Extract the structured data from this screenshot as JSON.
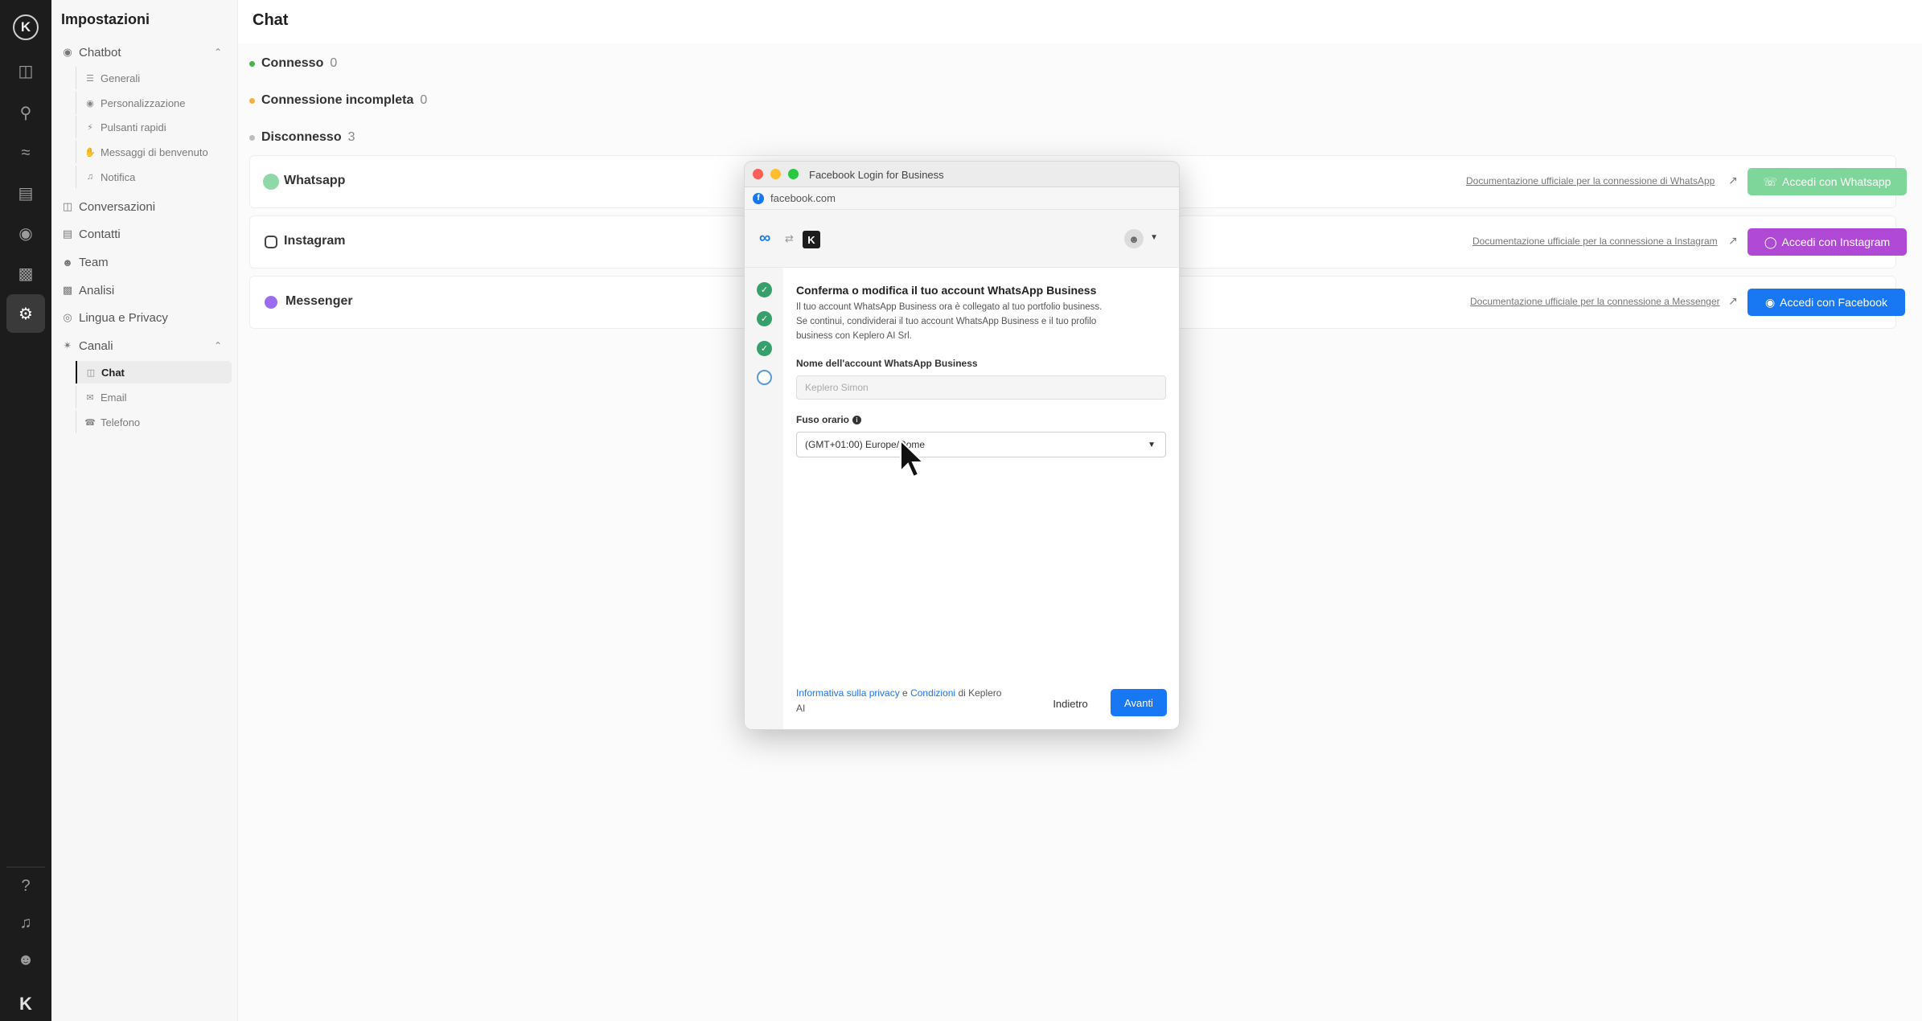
{
  "rail": {
    "items": [
      "logo",
      "chat-bubbles-icon",
      "location-pin-icon",
      "routing-icon",
      "contacts-book-icon",
      "bot-icon",
      "bar-chart-icon",
      "gear-icon"
    ],
    "bottom": [
      "help-icon",
      "bell-icon",
      "user-icon"
    ]
  },
  "sidebar": {
    "title": "Impostazioni",
    "chatbot": "Chatbot",
    "chatbot_items": [
      "Generali",
      "Personalizzazione",
      "Pulsanti rapidi",
      "Messaggi di benvenuto",
      "Notifica"
    ],
    "conversazioni": "Conversazioni",
    "contatti": "Contatti",
    "team": "Team",
    "analisi": "Analisi",
    "lingua": "Lingua e Privacy",
    "canali": "Canali",
    "canali_items": [
      "Chat",
      "Email",
      "Telefono"
    ]
  },
  "main": {
    "title": "Chat",
    "status": [
      {
        "label": "Connesso",
        "count": "0",
        "color": "#4caf50"
      },
      {
        "label": "Connessione incompleta",
        "count": "0",
        "color": "#f5b041"
      },
      {
        "label": "Disconnesso",
        "count": "3",
        "color": "#bdbdbd"
      }
    ],
    "channels": [
      {
        "name": "Whatsapp",
        "doc": "Documentazione ufficiale per la connessione di WhatsApp",
        "button": "Accedi con Whatsapp",
        "color": "#54c17a"
      },
      {
        "name": "Instagram",
        "doc": "Documentazione ufficiale per la connessione a Instagram",
        "button": "Accedi con Instagram",
        "color": "#b04ad6"
      },
      {
        "name": "Messenger",
        "doc": "Documentazione ufficiale per la connessione a Messenger",
        "button": "Accedi con Facebook",
        "color": "#1877f2"
      }
    ]
  },
  "popup": {
    "window_title": "Facebook Login for Business",
    "url": "facebook.com",
    "heading": "Conferma o modifica il tuo account WhatsApp Business",
    "desc1": "Il tuo account WhatsApp Business ora è collegato al tuo portfolio business.",
    "desc2": "Se continui, condividerai il tuo account WhatsApp Business e il tuo profilo",
    "desc3": "business con Keplero AI Srl.",
    "name_label": "Nome dell'account WhatsApp Business",
    "name_placeholder": "Keplero Simon",
    "tz_label": "Fuso orario",
    "tz_value": "(GMT+01:00) Europe/Rome",
    "footer_privacy": "Informativa sulla privacy",
    "footer_and": " e ",
    "footer_terms": "Condizioni",
    "footer_rest": " di Keplero",
    "footer_ai": "AI",
    "back": "Indietro",
    "next": "Avanti"
  }
}
